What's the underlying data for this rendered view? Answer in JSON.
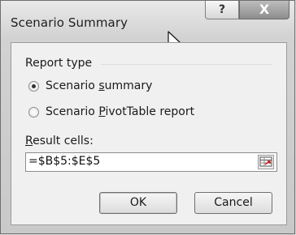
{
  "window": {
    "title": "Scenario Summary",
    "help_glyph": "?",
    "close_glyph": "X"
  },
  "report_type": {
    "label": "Report type",
    "options": [
      {
        "pre": "Scenario ",
        "key": "s",
        "post": "ummary",
        "selected": true
      },
      {
        "pre": "Scenario ",
        "key": "P",
        "post": "ivotTable report",
        "selected": false
      }
    ]
  },
  "result_cells": {
    "label_key": "R",
    "label_rest": "esult cells:",
    "value": "=$B$5:$E$5"
  },
  "buttons": {
    "ok": "OK",
    "cancel": "Cancel"
  },
  "icons": {
    "help": "help-icon",
    "close": "close-icon",
    "cursor": "mouse-pointer-icon",
    "collapse": "collapse-dialog-icon"
  }
}
